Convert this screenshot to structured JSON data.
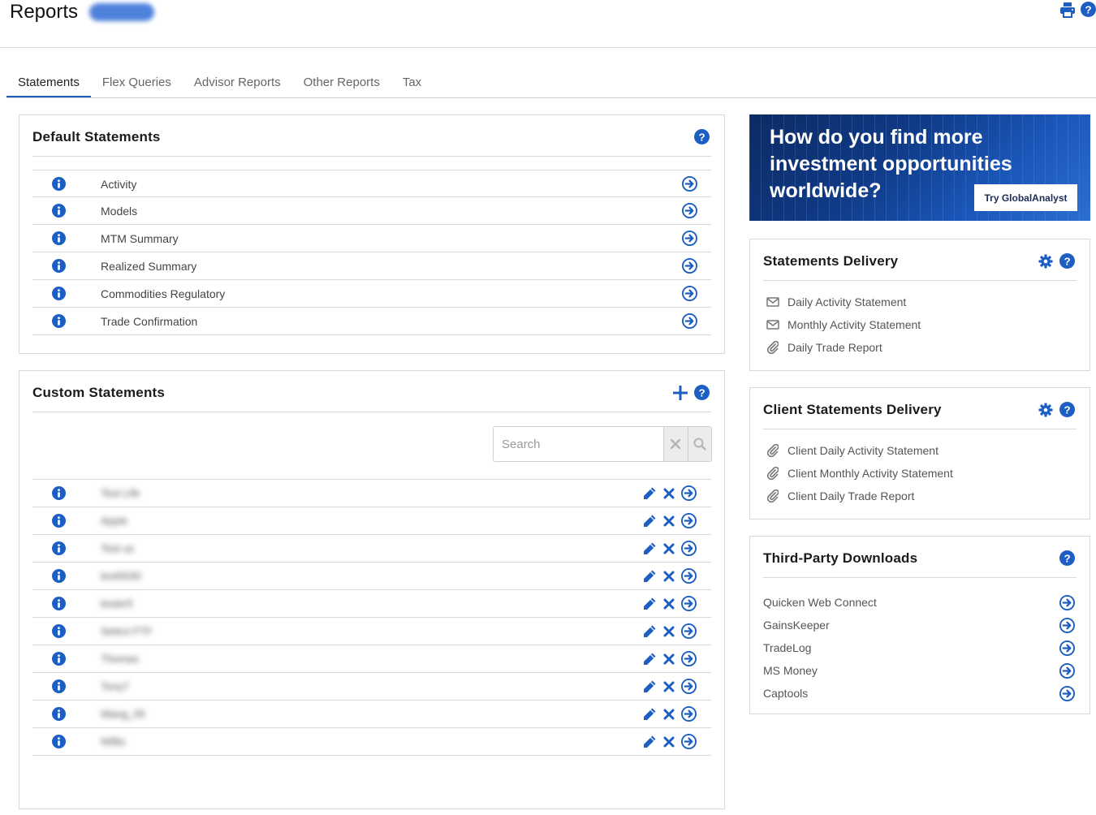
{
  "header": {
    "title": "Reports"
  },
  "tabs": [
    {
      "label": "Statements"
    },
    {
      "label": "Flex Queries"
    },
    {
      "label": "Advisor Reports"
    },
    {
      "label": "Other Reports"
    },
    {
      "label": "Tax"
    }
  ],
  "default_statements": {
    "title": "Default Statements",
    "items": [
      {
        "label": "Activity"
      },
      {
        "label": "Models"
      },
      {
        "label": "MTM Summary"
      },
      {
        "label": "Realized Summary"
      },
      {
        "label": "Commodities Regulatory"
      },
      {
        "label": "Trade Confirmation"
      }
    ]
  },
  "custom_statements": {
    "title": "Custom Statements",
    "search": {
      "placeholder": "Search",
      "value": ""
    },
    "rows": [
      {
        "name": "Test Life"
      },
      {
        "name": "Apple"
      },
      {
        "name": "Test us"
      },
      {
        "name": "test0030"
      },
      {
        "name": "tester5"
      },
      {
        "name": "Select FTF"
      },
      {
        "name": "Thomas"
      },
      {
        "name": "Tony7"
      },
      {
        "name": "Wang_05"
      },
      {
        "name": "Willis"
      }
    ]
  },
  "ad": {
    "headline": "How do you find more investment opportunities worldwide?",
    "cta": "Try GlobalAnalyst"
  },
  "statements_delivery": {
    "title": "Statements Delivery",
    "items": [
      {
        "label": "Daily Activity Statement",
        "icon": "envelope-icon"
      },
      {
        "label": "Monthly Activity Statement",
        "icon": "envelope-icon"
      },
      {
        "label": "Daily Trade Report",
        "icon": "paperclip-icon"
      }
    ]
  },
  "client_statements_delivery": {
    "title": "Client Statements Delivery",
    "items": [
      {
        "label": "Client Daily Activity Statement",
        "icon": "paperclip-icon"
      },
      {
        "label": "Client Monthly Activity Statement",
        "icon": "paperclip-icon"
      },
      {
        "label": "Client Daily Trade Report",
        "icon": "paperclip-icon"
      }
    ]
  },
  "third_party_downloads": {
    "title": "Third-Party Downloads",
    "items": [
      {
        "label": "Quicken Web Connect"
      },
      {
        "label": "GainsKeeper"
      },
      {
        "label": "TradeLog"
      },
      {
        "label": "MS Money"
      },
      {
        "label": "Captools"
      }
    ]
  },
  "colors": {
    "accent": "#1d5ec2",
    "border": "#d9d9d9",
    "text": "#444444"
  }
}
